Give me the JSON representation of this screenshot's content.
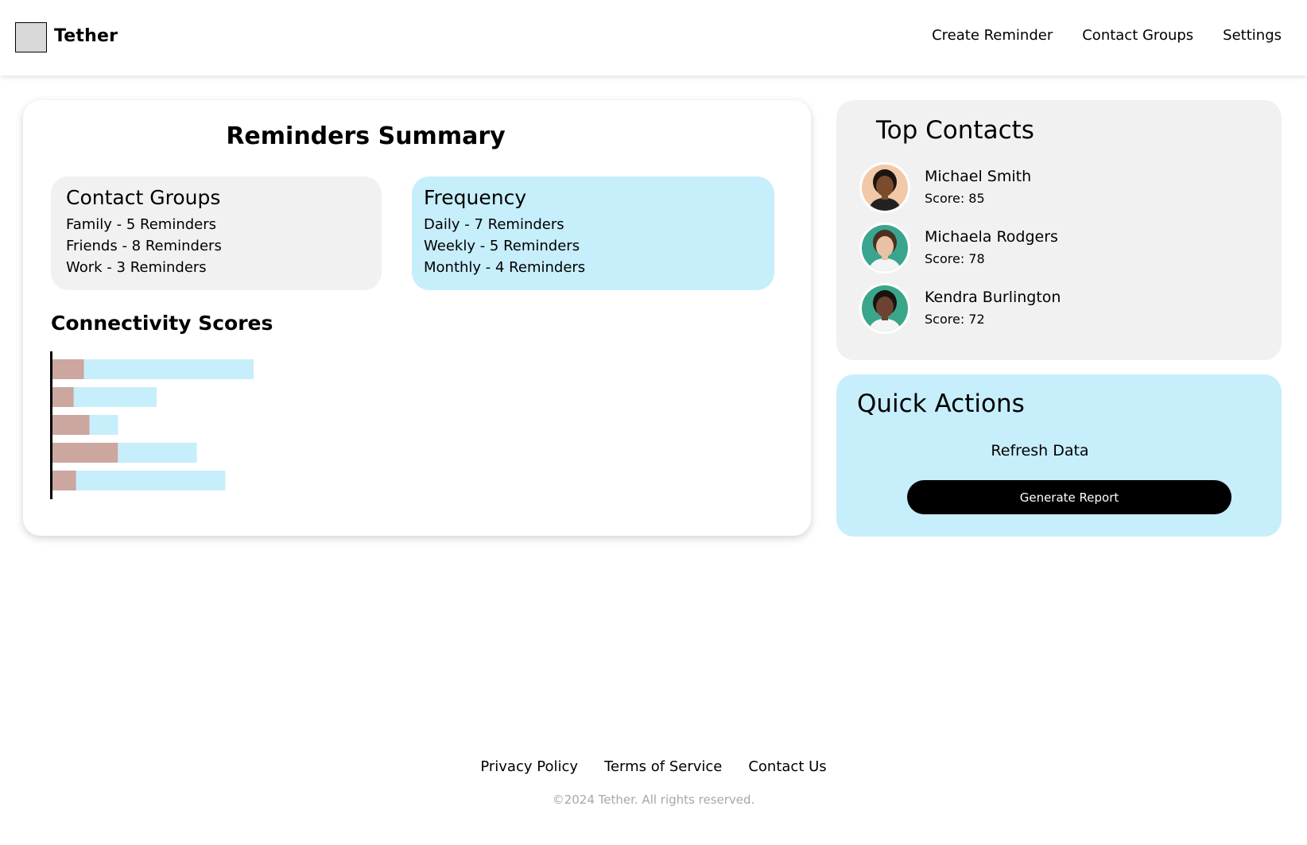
{
  "header": {
    "brand": "Tether",
    "nav": [
      "Create Reminder",
      "Contact Groups",
      "Settings"
    ]
  },
  "summary": {
    "title": "Reminders Summary",
    "groups": {
      "title": "Contact Groups",
      "lines": [
        "Family - 5 Reminders",
        "Friends - 8 Reminders",
        "Work - 3 Reminders"
      ]
    },
    "frequency": {
      "title": "Frequency",
      "lines": [
        "Daily - 7 Reminders",
        "Weekly - 5 Reminders",
        "Monthly - 4 Reminders"
      ]
    },
    "connectivity_title": "Connectivity Scores"
  },
  "chart_data": {
    "type": "bar",
    "orientation": "horizontal",
    "stacked": true,
    "categories": [
      "",
      "",
      "",
      "",
      ""
    ],
    "series": [
      {
        "values": [
          40,
          27,
          47,
          83,
          30
        ],
        "color": "#cba79f"
      },
      {
        "values": [
          215,
          105,
          36,
          100,
          189
        ],
        "color": "#c7eefb"
      }
    ],
    "xlim": [
      0,
      400
    ]
  },
  "contacts": {
    "title": "Top Contacts",
    "items": [
      {
        "name": "Michael Smith",
        "score": "Score: 85",
        "bg": "#f2c9a8",
        "skin": "#7b4b2e",
        "hair": "#1b1410"
      },
      {
        "name": "Michaela Rodgers",
        "score": "Score: 78",
        "bg": "#3aa58e",
        "skin": "#e9c2a6",
        "hair": "#4a3020"
      },
      {
        "name": "Kendra Burlington",
        "score": "Score: 72",
        "bg": "#3ba58a",
        "skin": "#6b4330",
        "hair": "#1a1210"
      }
    ]
  },
  "quick_actions": {
    "title": "Quick Actions",
    "refresh": "Refresh Data",
    "generate": "Generate Report"
  },
  "footer": {
    "links": [
      "Privacy Policy",
      "Terms of Service",
      "Contact Us"
    ],
    "copyright": "©2024 Tether. All rights reserved."
  }
}
